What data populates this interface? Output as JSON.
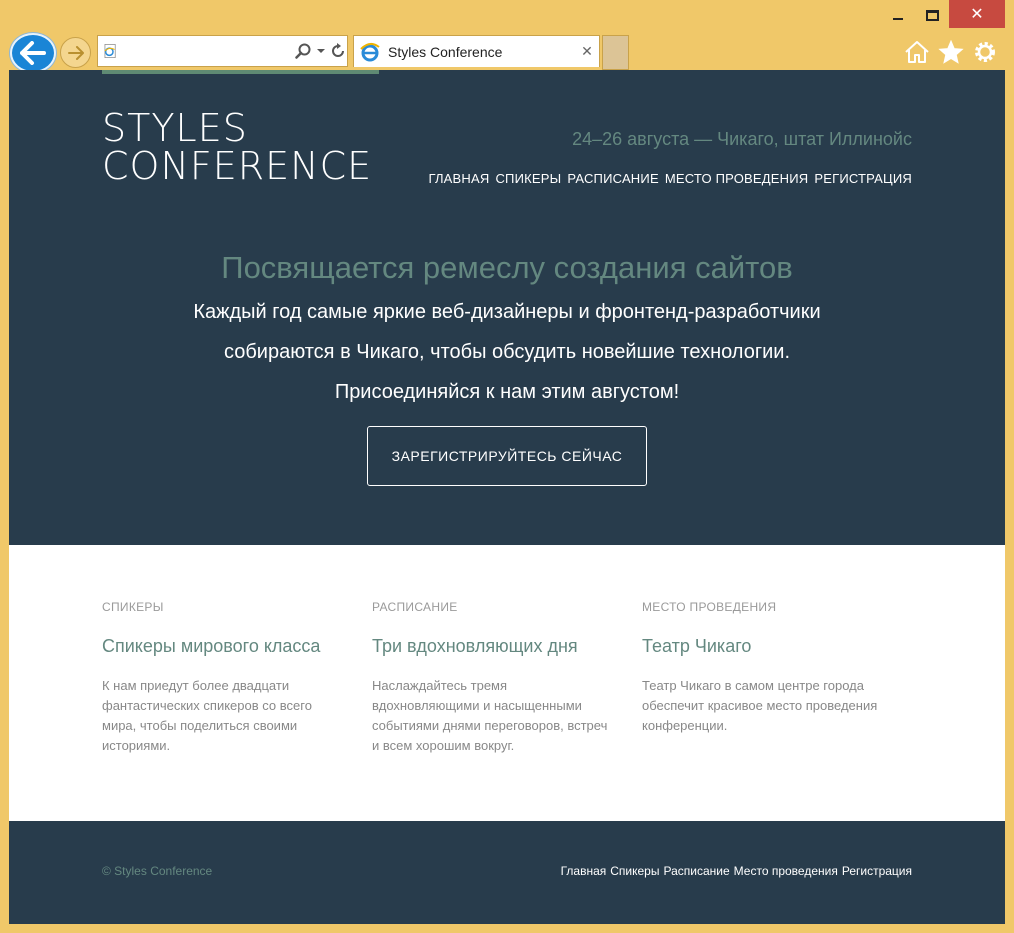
{
  "browser": {
    "tab_title": "Styles Conference",
    "address_value": "",
    "address_placeholder": ""
  },
  "site": {
    "logo_line1": "STYLES",
    "logo_line2": "CONFERENCE",
    "dates": "24–26 августа — Чикаго, штат Иллинойс",
    "nav": [
      "ГЛАВНАЯ",
      "СПИКЕРЫ",
      "РАСПИСАНИЕ",
      "МЕСТО ПРОВЕДЕНИЯ",
      "РЕГИСТРАЦИЯ"
    ]
  },
  "hero": {
    "title": "Посвящается ремеслу создания сайтов",
    "lead_line1": "Каждый год самые яркие веб-дизайнеры и фронтенд-разработчики",
    "lead_line2": "собираются в Чикаго, чтобы обсудить новейшие технологии.",
    "lead_line3": "Присоединяйся к нам этим августом!",
    "cta": "ЗАРЕГИСТРИРУЙТЕСЬ СЕЙЧАС"
  },
  "teasers": [
    {
      "kicker": "СПИКЕРЫ",
      "heading": "Спикеры мирового класса",
      "text": "К нам приедут более двадцати фантастических спикеров со всего мира, чтобы поделиться своими историями."
    },
    {
      "kicker": "РАСПИСАНИЕ",
      "heading": "Три вдохновляющих дня",
      "text": "Наслаждайтесь тремя вдохновляющими и насыщенными событиями днями переговоров, встреч и всем хорошим вокруг."
    },
    {
      "kicker": "МЕСТО ПРОВЕДЕНИЯ",
      "heading": "Театр Чикаго",
      "text": "Театр Чикаго в самом центре города обеспечит красивое место проведения конференции."
    }
  ],
  "footer": {
    "copyright": "© Styles Conference",
    "nav": [
      "Главная",
      "Спикеры",
      "Расписание",
      "Место проведения",
      "Регистрация"
    ]
  },
  "colors": {
    "dark": "#283c4c",
    "accent": "#648880",
    "chrome": "#f0c869"
  }
}
